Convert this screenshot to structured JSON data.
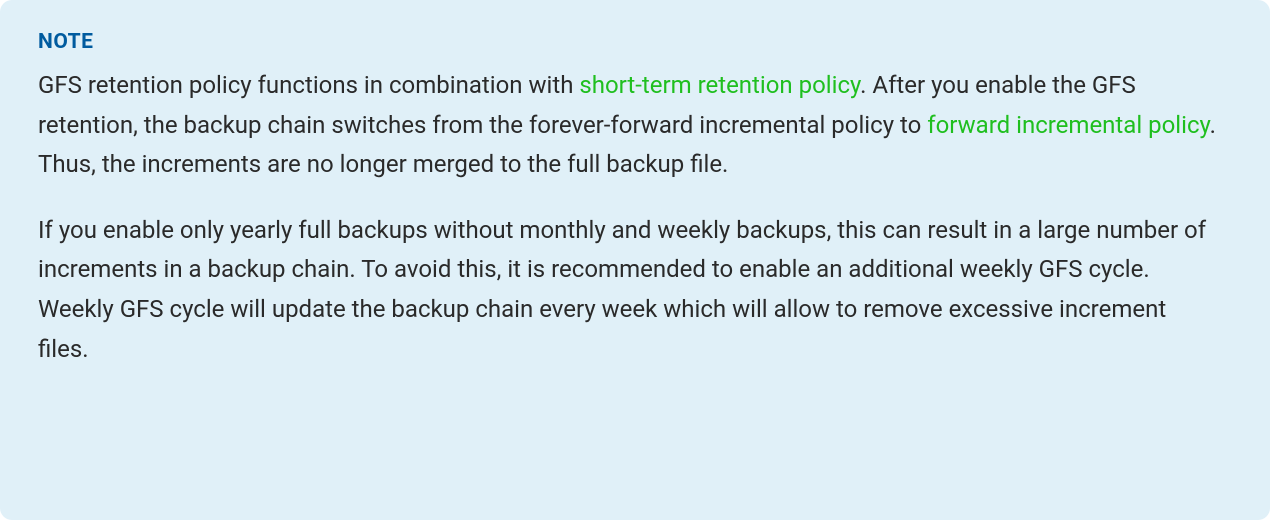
{
  "note": {
    "heading": "NOTE",
    "p1_part1": "GFS retention policy functions in combination with ",
    "p1_link1": "short-term retention policy",
    "p1_part2": ". After you enable the GFS retention, the backup chain switches from the forever-forward incremental policy to ",
    "p1_link2": "forward incremental policy",
    "p1_part3": ". Thus, the increments are no longer merged to the full backup file.",
    "p2": "If you enable only yearly full backups without monthly and weekly backups, this can result in a large number of increments in a backup chain. To avoid this, it is recommended to enable an additional weekly GFS cycle. Weekly GFS cycle will update the backup chain every week which will allow to remove excessive increment files."
  }
}
